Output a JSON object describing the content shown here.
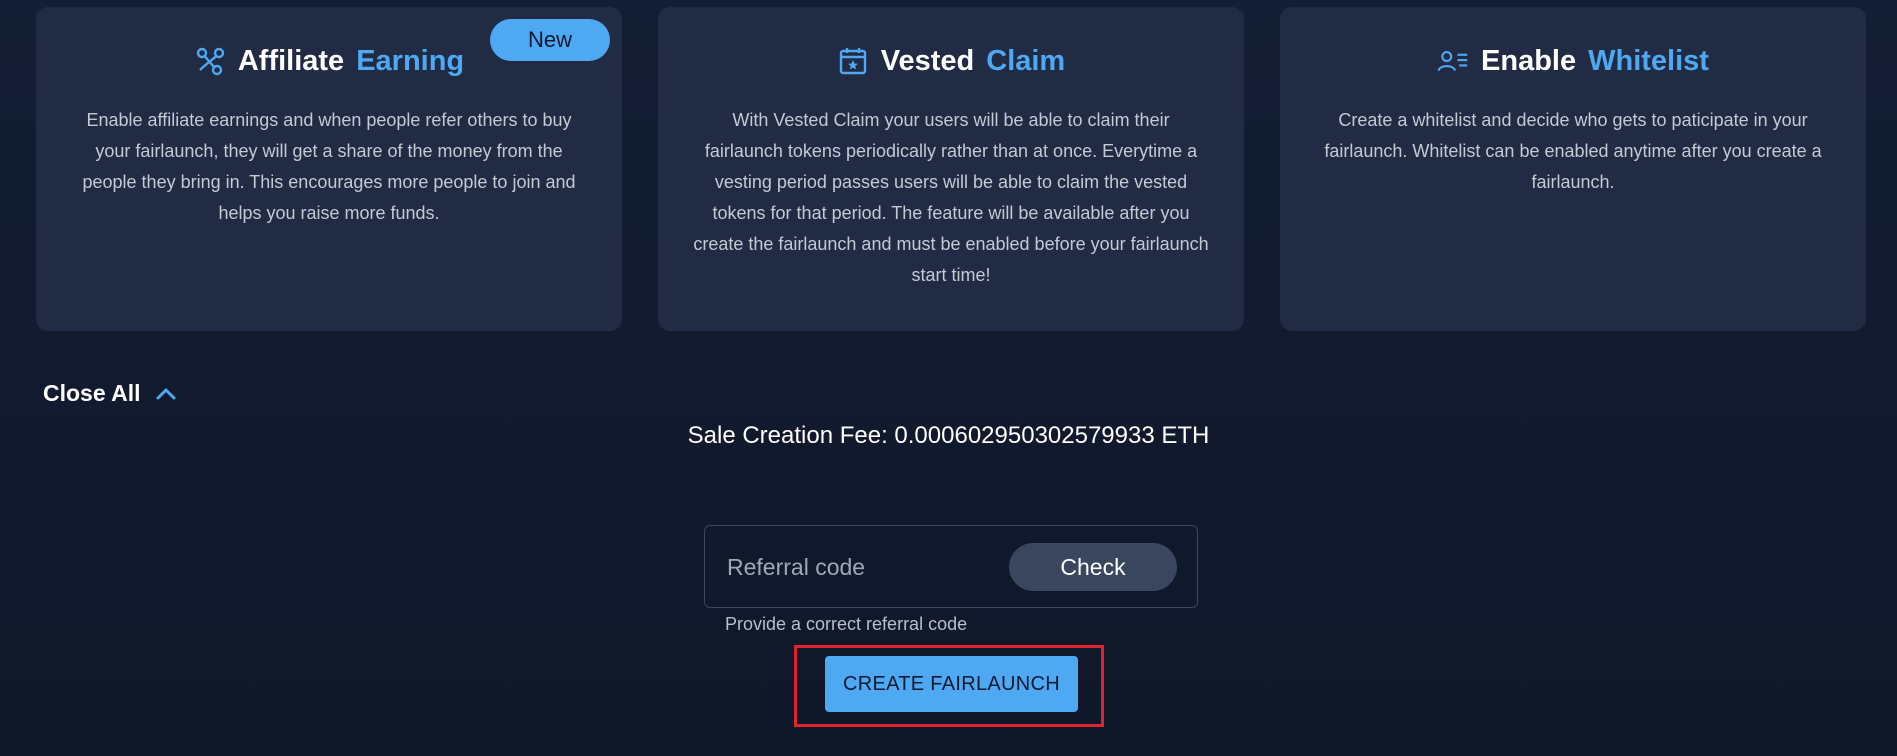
{
  "cards": [
    {
      "icon": "affiliate-icon",
      "title": "Affiliate",
      "accent": "Earning",
      "badge": "New",
      "description": "Enable affiliate earnings and when people refer others to buy your fairlaunch, they will get a share of the money from the people they bring in. This encourages more people to join and helps you raise more funds."
    },
    {
      "icon": "calendar-icon",
      "title": "Vested",
      "accent": "Claim",
      "description": "With Vested Claim your users will be able to claim their fairlaunch tokens periodically rather than at once. Everytime a vesting period passes users will be able to claim the vested tokens for that period. The feature will be available after you create the fairlaunch and must be enabled before your fairlaunch start time!"
    },
    {
      "icon": "user-list-icon",
      "title": "Enable",
      "accent": "Whitelist",
      "description": "Create a whitelist and decide who gets to paticipate in your fairlaunch. Whitelist can be enabled anytime after you create a fairlaunch."
    }
  ],
  "close_all": {
    "label": "Close All",
    "icon": "chevron-up-icon"
  },
  "fee": {
    "text": "Sale Creation Fee: 0.000602950302579933 ETH"
  },
  "referral": {
    "placeholder": "Referral code",
    "value": "",
    "check_label": "Check",
    "hint": "Provide a correct referral code"
  },
  "create_button": {
    "label": "CREATE FAIRLAUNCH"
  },
  "colors": {
    "accent": "#4ea8f2",
    "card_bg": "#212b44",
    "page_bg": "#111a2e",
    "highlight": "#e0242f"
  }
}
